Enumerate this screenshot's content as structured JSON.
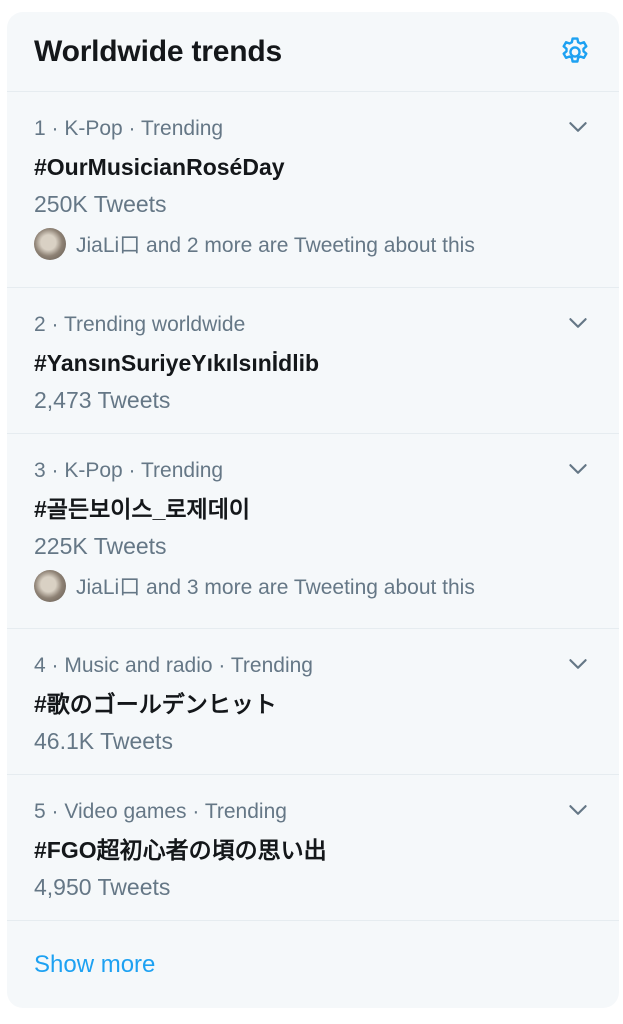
{
  "header": {
    "title": "Worldwide trends"
  },
  "trends": [
    {
      "meta": "1 · K-Pop · Trending",
      "name": "#OurMusicianRoséDay",
      "count": "250K Tweets",
      "social": "JiaLi口 and 2 more are Tweeting about this"
    },
    {
      "meta": "2 · Trending worldwide",
      "name": "#YansınSuriyeYıkılsınİdlib",
      "count": "2,473 Tweets"
    },
    {
      "meta": "3 · K-Pop · Trending",
      "name": "#골든보이스_로제데이",
      "count": "225K Tweets",
      "social": "JiaLi口 and 3 more are Tweeting about this"
    },
    {
      "meta": "4 · Music and radio · Trending",
      "name": "#歌のゴールデンヒット",
      "count": "46.1K Tweets"
    },
    {
      "meta": "5 · Video games · Trending",
      "name": "#FGO超初心者の頃の思い出",
      "count": "4,950 Tweets"
    }
  ],
  "footer": {
    "show_more": "Show more"
  },
  "colors": {
    "accent": "#1da1f2",
    "secondary_text": "#657786",
    "panel_bg": "#f5f8fa"
  },
  "icons": {
    "settings": "gear-icon",
    "more": "chevron-down-icon"
  }
}
